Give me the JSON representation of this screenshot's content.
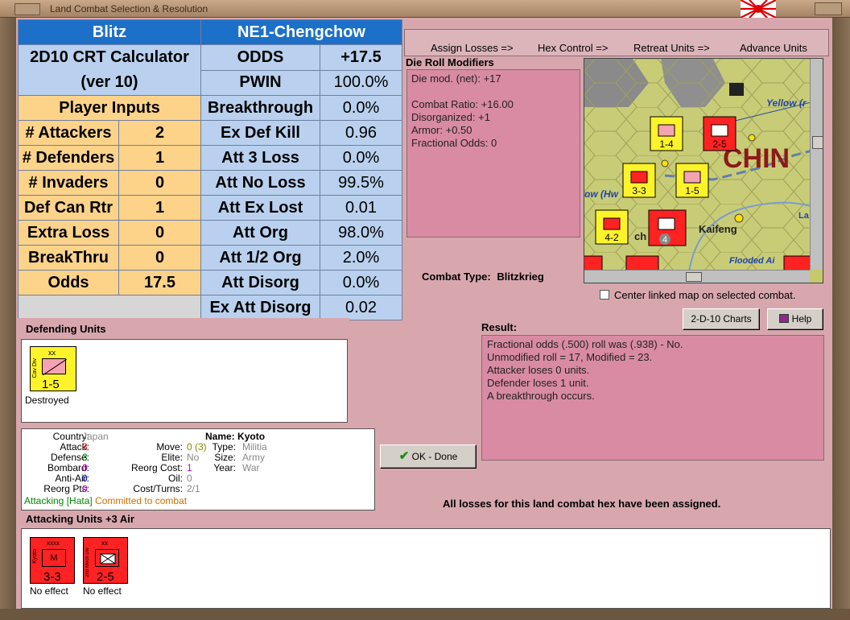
{
  "window": {
    "title": "Land Combat Selection & Resolution"
  },
  "crt": {
    "title_left": "Blitz",
    "title_right": "NE1-Chengchow",
    "calc_line1": "2D10 CRT Calculator",
    "calc_line2": "(ver 10)",
    "player_inputs": "Player Inputs",
    "inputs": [
      {
        "label": "# Attackers",
        "value": "2"
      },
      {
        "label": "# Defenders",
        "value": "1"
      },
      {
        "label": "# Invaders",
        "value": "0"
      },
      {
        "label": "Def Can Rtr",
        "value": "1"
      },
      {
        "label": "Extra Loss",
        "value": "0"
      },
      {
        "label": "BreakThru",
        "value": "0"
      },
      {
        "label": "Odds",
        "value": "17.5"
      }
    ],
    "results": [
      {
        "label": "ODDS",
        "value": "+17.5"
      },
      {
        "label": "PWIN",
        "value": "100.0%"
      },
      {
        "label": "Breakthrough",
        "value": "0.0%"
      },
      {
        "label": "Ex Def Kill",
        "value": "0.96"
      },
      {
        "label": "Att 3 Loss",
        "value": "0.0%"
      },
      {
        "label": "Att No Loss",
        "value": "99.5%"
      },
      {
        "label": "Att Ex Lost",
        "value": "0.01"
      },
      {
        "label": "Att Org",
        "value": "98.0%"
      },
      {
        "label": "Att 1/2 Org",
        "value": "2.0%"
      },
      {
        "label": "Att Disorg",
        "value": "0.0%"
      },
      {
        "label": "Ex Att Disorg",
        "value": "0.02"
      }
    ]
  },
  "phases": [
    "Assign Losses =>",
    "Hex Control =>",
    "Retreat Units =>",
    "Advance Units"
  ],
  "modifiers": {
    "title": "Die Roll Modifiers",
    "lines": [
      "Die mod. (net): +17",
      "",
      "Combat Ratio: +16.00",
      "Disorganized: +1",
      "Armor: +0.50",
      "Fractional Odds: 0"
    ]
  },
  "combat_type": {
    "label": "Combat Type:",
    "value": "Blitzkrieg"
  },
  "map": {
    "labels": [
      "Yellow (r",
      "CHIN",
      "ow (Hw",
      "Kaifeng",
      "La",
      "Flooded Ai",
      "ch"
    ],
    "center_checkbox": "Center linked map on selected combat."
  },
  "buttons": {
    "charts": "2-D-10 Charts",
    "help": "Help",
    "ok": "OK - Done"
  },
  "result": {
    "title": "Result:",
    "lines": [
      "Fractional odds (.500) roll was (.938)  - No.",
      "Unmodified roll = 17, Modified = 23.",
      "Attacker loses 0 units.",
      "Defender loses 1 unit.",
      "A breakthrough occurs."
    ]
  },
  "defending": {
    "title": "Defending Units",
    "units": [
      {
        "type": "Cav Div",
        "size": "xx",
        "strength": "1-5",
        "status": "Destroyed"
      }
    ]
  },
  "unit_info": {
    "country_label": "Country:",
    "country": "Japan",
    "attack_label": "Attack:",
    "attack": "3",
    "defense_label": "Defense:",
    "defense": "3",
    "bombard_label": "Bombard:",
    "bombard": "0",
    "antiair_label": "Anti-Air:",
    "antiair": "0",
    "reorg_label": "Reorg Pts:",
    "reorg": "0",
    "name_label": "Name:",
    "name": "Kyoto",
    "move_label": "Move:",
    "move": "0 (3)",
    "elite_label": "Elite:",
    "elite": "No",
    "reorgcost_label": "Reorg Cost:",
    "reorgcost": "1",
    "oil_label": "Oil:",
    "oil": "0",
    "costturns_label": "Cost/Turns:",
    "costturns": "2/1",
    "type_label": "Type:",
    "type": "Militia",
    "size_label": "Size:",
    "size": "Army",
    "year_label": "Year:",
    "year": "War",
    "attacking_hata": "Attacking [Hata]",
    "committed": "Committed to combat"
  },
  "losses_msg": "All losses for this land combat hex have been assigned.",
  "attacking": {
    "title": "Attacking Units +3 Air",
    "units": [
      {
        "type": "Kyoto",
        "size": "xxxx",
        "strength": "3-3",
        "status": "No effect"
      },
      {
        "type": "2nd Mech Div",
        "size": "xx",
        "strength": "2-5",
        "status": "No effect"
      }
    ]
  }
}
